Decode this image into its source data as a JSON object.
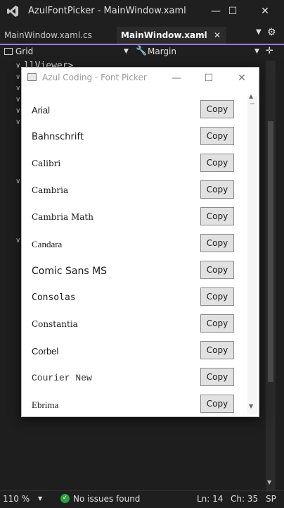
{
  "window": {
    "title": "AzulFontPicker - MainWindow.xaml"
  },
  "tabs": [
    {
      "label": "MainWindow.xaml.cs"
    },
    {
      "label": "MainWindow.xaml"
    }
  ],
  "navbar": {
    "left_label": "Grid",
    "right_label": "Margin"
  },
  "editor": {
    "code_line": "llViewer>"
  },
  "status": {
    "zoom": "110 %",
    "issues": "No issues found",
    "line": "Ln: 14",
    "col": "Ch: 35",
    "mode": "SP"
  },
  "font_picker": {
    "title": "Azul Coding - Font Picker",
    "copy_label": "Copy",
    "fonts": [
      "Arial",
      "Bahnschrift",
      "Calibri",
      "Cambria",
      "Cambria Math",
      "Candara",
      "Comic Sans MS",
      "Consolas",
      "Constantia",
      "Corbel",
      "Courier New",
      "Ebrima"
    ]
  },
  "colors": {
    "accent": "#9d7bdc",
    "ok": "#2ea043",
    "background": "#1f1f1f"
  }
}
